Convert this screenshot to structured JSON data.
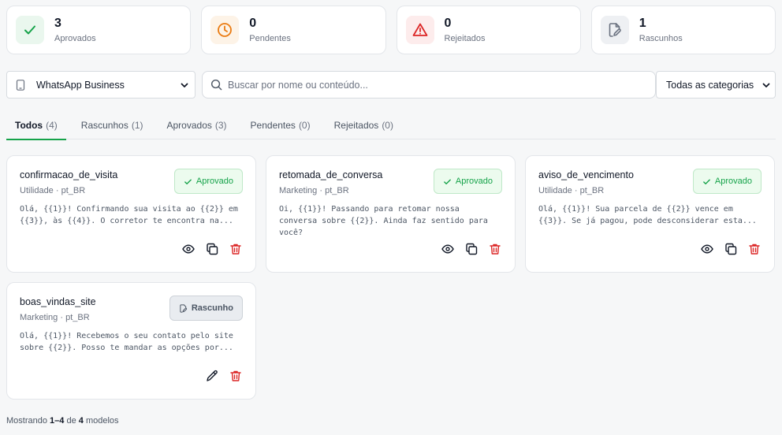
{
  "stats": [
    {
      "count": "3",
      "label": "Aprovados",
      "icon": "check-icon",
      "color": "#16a34a",
      "bg": "#eaf7ee"
    },
    {
      "count": "0",
      "label": "Pendentes",
      "icon": "clock-icon",
      "color": "#ea7b12",
      "bg": "#fdf3e7"
    },
    {
      "count": "0",
      "label": "Rejeitados",
      "icon": "alert-triangle-icon",
      "color": "#dc2626",
      "bg": "#fdecec"
    },
    {
      "count": "1",
      "label": "Rascunhos",
      "icon": "file-edit-icon",
      "color": "#6b7280",
      "bg": "#eef0f3"
    }
  ],
  "filters": {
    "channel": "WhatsApp Business",
    "search_placeholder": "Buscar por nome ou conteúdo...",
    "category": "Todas as categorias"
  },
  "tabs": [
    {
      "label": "Todos",
      "count": "(4)"
    },
    {
      "label": "Rascunhos",
      "count": "(1)"
    },
    {
      "label": "Aprovados",
      "count": "(3)"
    },
    {
      "label": "Pendentes",
      "count": "(0)"
    },
    {
      "label": "Rejeitados",
      "count": "(0)"
    }
  ],
  "cards": [
    {
      "name": "confirmacao_de_visita",
      "meta": "Utilidade · pt_BR",
      "body": "Olá, {{1}}! Confirmando sua visita ao {{2}} em {{3}}, às {{4}}. O corretor te encontra na...",
      "status": "Aprovado"
    },
    {
      "name": "retomada_de_conversa",
      "meta": "Marketing · pt_BR",
      "body": "Oi, {{1}}! Passando para retomar nossa conversa sobre {{2}}. Ainda faz sentido para você?",
      "status": "Aprovado"
    },
    {
      "name": "aviso_de_vencimento",
      "meta": "Utilidade · pt_BR",
      "body": "Olá, {{1}}! Sua parcela de {{2}} vence em {{3}}. Se já pagou, pode desconsiderar esta...",
      "status": "Aprovado"
    },
    {
      "name": "boas_vindas_site",
      "meta": "Marketing · pt_BR",
      "body": "Olá, {{1}}! Recebemos o seu contato pelo site sobre {{2}}. Posso te mandar as opções por...",
      "status": "Rascunho"
    }
  ],
  "footer": {
    "prefix": "Mostrando",
    "range": "1–4",
    "of": "de",
    "total": "4",
    "suffix": "modelos"
  }
}
